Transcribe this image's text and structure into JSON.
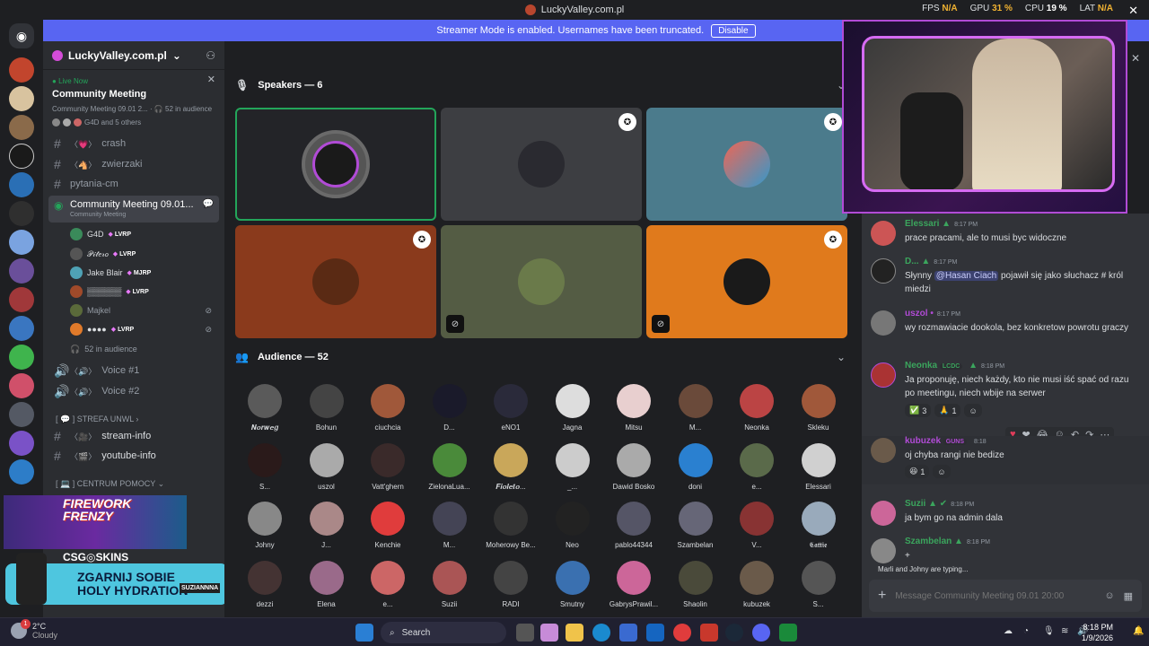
{
  "titlebar": {
    "title": "LuckyValley.com.pl"
  },
  "perf": {
    "fps_label": "FPS",
    "fps": "N/A",
    "gpu_label": "GPU",
    "gpu": "31 %",
    "cpu_label": "CPU",
    "cpu": "19 %",
    "lat_label": "LAT",
    "lat": "N/A"
  },
  "banner": {
    "text": "Streamer Mode is enabled. Usernames have been truncated.",
    "button": "Disable"
  },
  "server": {
    "name": "LuckyValley.com.pl"
  },
  "live": {
    "status": "Live Now",
    "title": "Community Meeting",
    "subtitle": "Community Meeting 09.01 2...",
    "audience": "52 in audience",
    "others": "G4D and 5 others"
  },
  "channels": {
    "crash": "crash",
    "zwierzaki": "zwierzaki",
    "pytania": "pytania-cm",
    "stage": "Community Meeting 09.01...",
    "stage_sub": "Community Meeting",
    "audience_count": "52 in audience",
    "voice1": "Voice #1",
    "voice2": "Voice #2",
    "cat_strefa": "STREFA UNWL",
    "stream_info": "stream-info",
    "youtube_info": "youtube-info",
    "cat_centrum": "CENTRUM POMOCY"
  },
  "stage_users": [
    {
      "name": "G4D",
      "role": "LVRP"
    },
    {
      "name": "𝒫𝒾𝓉𝑒𝓇𝑜",
      "role": "LVRP"
    },
    {
      "name": "Jake Blair",
      "role": "MJRP"
    },
    {
      "name": "▒▒▒▒▒▒",
      "role": "LVRP"
    },
    {
      "name": "Majkel",
      "role": ""
    },
    {
      "name": "●●●●",
      "role": "LVRP"
    }
  ],
  "ad": {
    "line1": "FIREWORK",
    "line2": "FRENZY",
    "brand": "CSG◎SKINS",
    "slogan1": "ZGARNIJ SOBIE",
    "slogan2": "HOLY HYDRATION",
    "tag": "SUZIANNNA"
  },
  "main": {
    "speakers_label": "Speakers — 6",
    "audience_label": "Audience — 52"
  },
  "audience": [
    "𝑵𝒐𝒓𝒘𝒆𝒈",
    "Bohun",
    "ciuchcia",
    "D...",
    "eNO1",
    "Jagna",
    "Mitsu",
    "M...",
    "Neonka",
    "Skleku",
    "S...",
    "uszol",
    "Vatt'ghern",
    "ZielonaLua...",
    "𝑭𝒊𝒐𝒍𝒆𝒕𝒐...",
    "_...",
    "Dawid Bosko",
    "doni",
    "e...",
    "Elessari",
    "Johny",
    "J...",
    "Kenchie",
    "M...",
    "Moherowy Be...",
    "Neo",
    "pablo44344",
    "Szambelan",
    "V...",
    "𝕮𝖆𝖙𝖙𝖎𝖊",
    "dezzi",
    "Elena",
    "e...",
    "Suzii",
    "RADI",
    "Smutny",
    "GabrysPrawil...",
    "Shaolin",
    "kubuzek",
    "S..."
  ],
  "chat": {
    "messages": [
      {
        "name": "Elessari",
        "time": "8:17 PM",
        "text": "prace pracami, ale to musi byc widoczne"
      },
      {
        "name": "D...",
        "time": "8:17 PM",
        "text_pre": "Słynny ",
        "mention": "@Hasan Ciach",
        "text_post": " pojawił się jako słuchacz # król miedzi"
      },
      {
        "name": "uszol",
        "time": "8:17 PM",
        "text": "wy rozmawiacie dookola, bez konkretow powrotu graczy"
      },
      {
        "name": "Neonka",
        "tag": "LCDC",
        "time": "8:18 PM",
        "text": "Ja proponuję, niech każdy, kto nie musi iść spać od razu po meetingu, niech wbije na serwer",
        "reactions": [
          "3",
          "1"
        ]
      },
      {
        "name": "kubuzek",
        "tag": "GUNS",
        "time": "8:18",
        "text": "oj chyba rangi nie bedize",
        "reactions": [
          "1"
        ]
      },
      {
        "name": "Suzii",
        "time": "8:18 PM",
        "text": "ja bym go na admin dala"
      },
      {
        "name": "Szambelan",
        "time": "8:18 PM",
        "text": "+"
      }
    ],
    "typing": "Marli and Johny are typing...",
    "placeholder": "Message Community Meeting 09.01 20:00"
  },
  "taskbar": {
    "temp": "2°C",
    "weather": "Cloudy",
    "badge": "1",
    "search": "Search",
    "time": "8:18 PM",
    "date": "1/9/2026"
  },
  "colors": {
    "accent": "#5865f2",
    "green": "#23a55a",
    "bg": "#1e1f22"
  }
}
